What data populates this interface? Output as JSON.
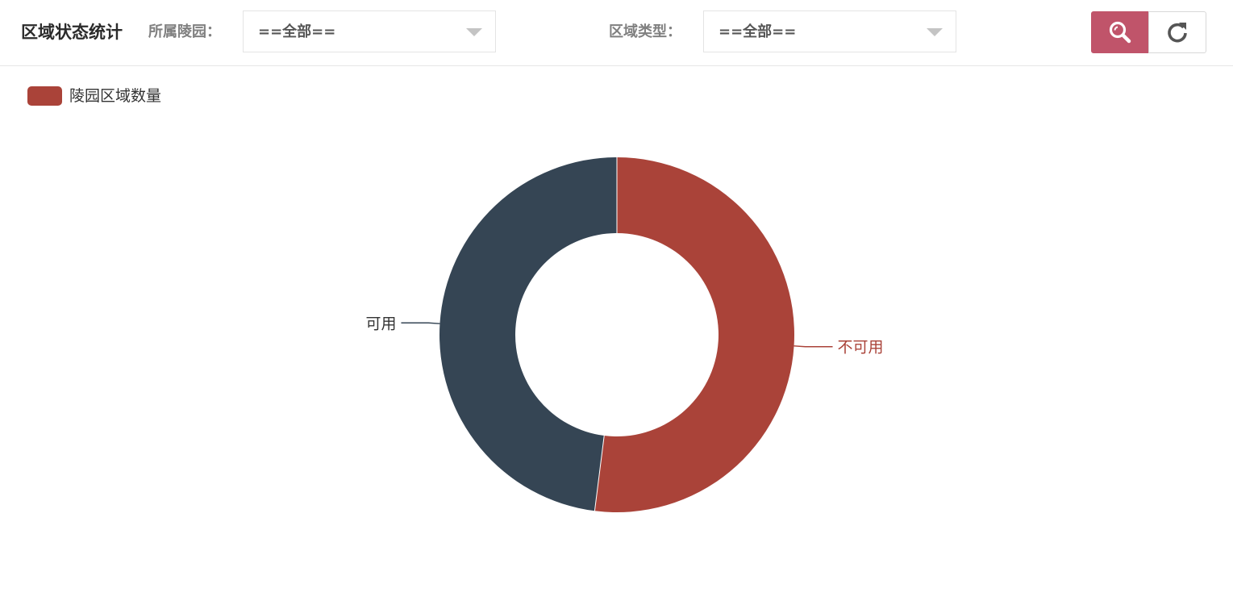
{
  "header": {
    "title": "区域状态统计",
    "cemetery_filter": {
      "label": "所属陵园：",
      "value": "==全部=="
    },
    "area_type_filter": {
      "label": "区域类型：",
      "value": "==全部=="
    },
    "buttons": {
      "search_icon": "search-icon",
      "reset_icon": "refresh-icon"
    }
  },
  "chart_data": {
    "type": "pie",
    "donut": true,
    "legend": [
      "陵园区域数量"
    ],
    "legend_position": "top-left",
    "series": [
      {
        "name": "陵园区域数量",
        "slices": [
          {
            "label": "不可用",
            "value": 52,
            "color": "#aa4339"
          },
          {
            "label": "可用",
            "value": 48,
            "color": "#354554"
          }
        ]
      }
    ]
  }
}
